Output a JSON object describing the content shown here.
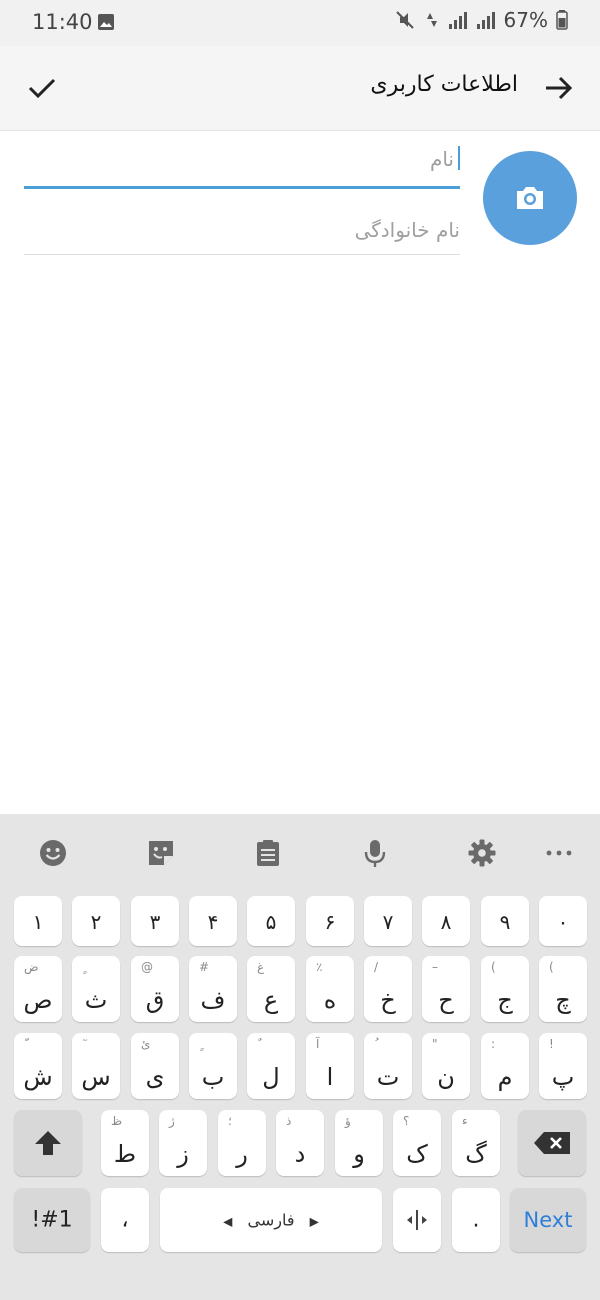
{
  "status_bar": {
    "time": "11:40",
    "battery_percent": "67%"
  },
  "toolbar": {
    "title": "اطلاعات کاربری"
  },
  "form": {
    "first_name_placeholder": "نام",
    "last_name_placeholder": "نام خانوادگی"
  },
  "keyboard": {
    "toolbar_icons": [
      "emoji-icon",
      "sticker-icon",
      "clipboard-icon",
      "mic-icon",
      "settings-icon",
      "more-icon"
    ],
    "number_row": [
      "۱",
      "۲",
      "۳",
      "۴",
      "۵",
      "۶",
      "۷",
      "۸",
      "۹",
      "۰"
    ],
    "row1": [
      {
        "main": "ص",
        "sub": "ض"
      },
      {
        "main": "ث",
        "sub": "ٍ"
      },
      {
        "main": "ق",
        "sub": "@"
      },
      {
        "main": "ف",
        "sub": "#"
      },
      {
        "main": "ع",
        "sub": "غ"
      },
      {
        "main": "ه",
        "sub": "٪"
      },
      {
        "main": "خ",
        "sub": "/"
      },
      {
        "main": "ح",
        "sub": "–"
      },
      {
        "main": "ج",
        "sub": "("
      },
      {
        "main": "چ",
        "sub": "("
      }
    ],
    "row2": [
      {
        "main": "ش",
        "sub": "ّ"
      },
      {
        "main": "س",
        "sub": "ٓ"
      },
      {
        "main": "ی",
        "sub": "ئ"
      },
      {
        "main": "ب",
        "sub": "ٍ"
      },
      {
        "main": "ل",
        "sub": "ٌ"
      },
      {
        "main": "ا",
        "sub": "آ"
      },
      {
        "main": "ت",
        "sub": "ُ"
      },
      {
        "main": "ن",
        "sub": "\""
      },
      {
        "main": "م",
        "sub": ":"
      },
      {
        "main": "پ",
        "sub": "!"
      }
    ],
    "row3": [
      {
        "main": "ط",
        "sub": "ظ"
      },
      {
        "main": "ز",
        "sub": "ژ"
      },
      {
        "main": "ر",
        "sub": "؛"
      },
      {
        "main": "د",
        "sub": "ذ"
      },
      {
        "main": "و",
        "sub": "ؤ"
      },
      {
        "main": "ک",
        "sub": "؟"
      },
      {
        "main": "گ",
        "sub": "ء"
      }
    ],
    "bottom": {
      "symbols": "!#1",
      "comma": "،",
      "space": "فارسی",
      "period": ".",
      "next": "Next"
    }
  }
}
